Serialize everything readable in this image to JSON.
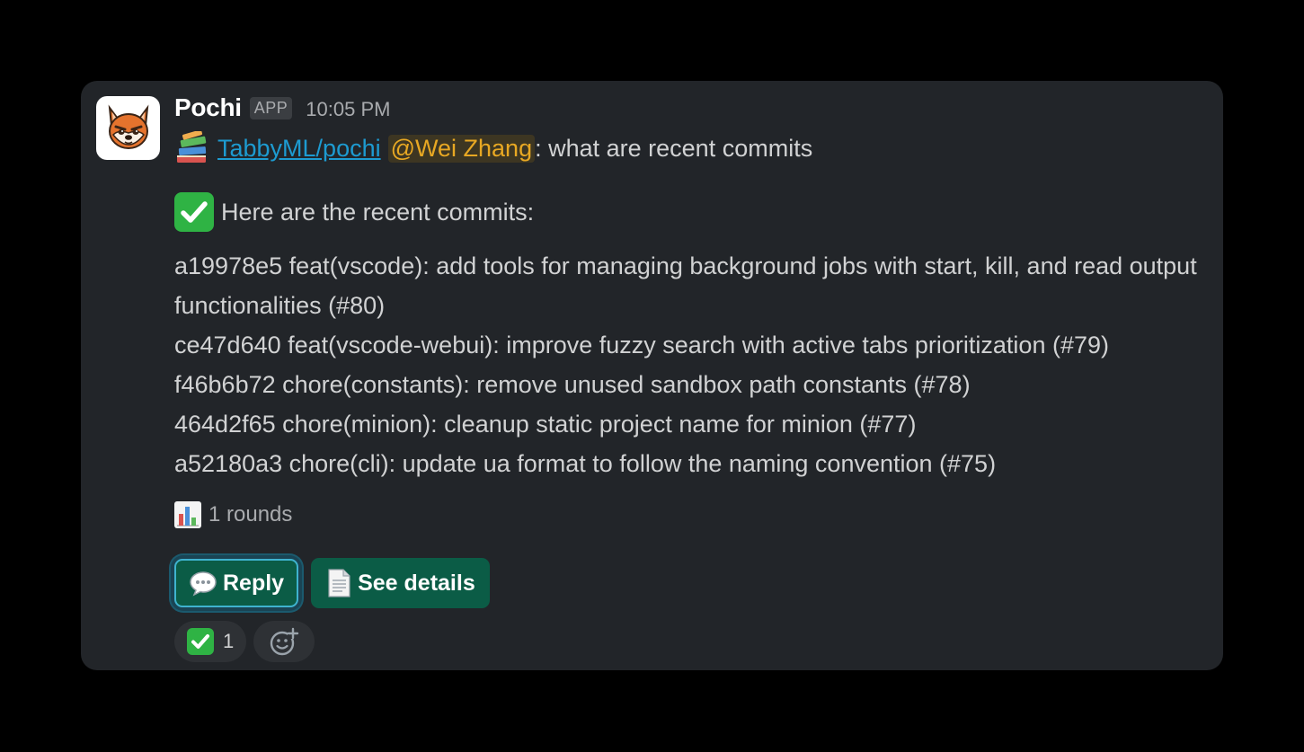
{
  "message": {
    "sender": "Pochi",
    "badge": "APP",
    "timestamp": "10:05 PM",
    "avatar_icon": "fox-avatar-icon",
    "question": {
      "emoji_icon": "books-icon",
      "repo_link": "TabbyML/pochi",
      "mention": "@Wei Zhang",
      "text": ": what are recent commits"
    },
    "answer_intro": {
      "emoji_icon": "check-mark-button-icon",
      "text": "Here are the recent commits:"
    },
    "commits": [
      "a19978e5 feat(vscode): add tools for managing background jobs with start, kill, and read output functionalities (#80)",
      "ce47d640 feat(vscode-webui): improve fuzzy search with active tabs prioritization (#79)",
      "f46b6b72 chore(constants): remove unused sandbox path constants (#78)",
      "464d2f65 chore(minion): cleanup static project name for minion (#77)",
      "a52180a3 chore(cli): update ua format to follow the naming convention (#75)"
    ],
    "rounds": {
      "emoji_icon": "bar-chart-icon",
      "text": "1 rounds"
    }
  },
  "buttons": {
    "reply": {
      "icon": "speech-balloon-icon",
      "label": "Reply"
    },
    "details": {
      "icon": "page-facing-up-icon",
      "label": "See details"
    }
  },
  "reactions": [
    {
      "icon": "check-mark-button-icon",
      "count": "1"
    }
  ],
  "add_reaction_icon": "add-emoji-icon",
  "colors": {
    "background": "#000000",
    "card": "#222529",
    "link": "#1d9bd1",
    "mention": "#e8a823",
    "button": "#0b5c46",
    "focus_ring": "#3fb3cf",
    "check_green": "#2fb344"
  }
}
